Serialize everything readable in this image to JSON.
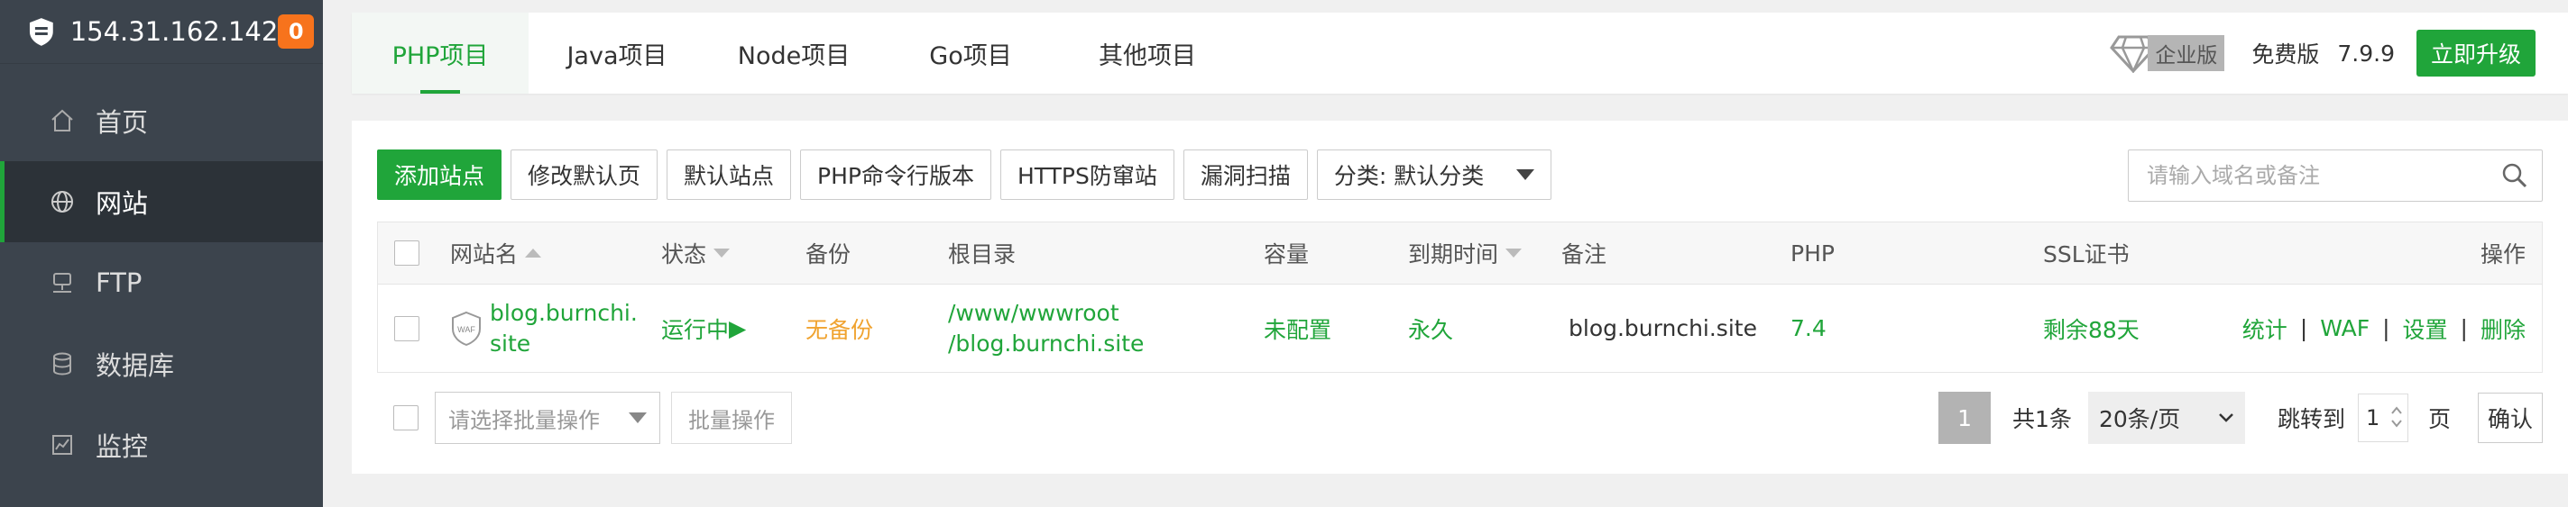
{
  "sidebar": {
    "server_ip": "154.31.162.142",
    "badge": "0",
    "items": [
      {
        "label": "首页",
        "icon": "home-icon"
      },
      {
        "label": "网站",
        "icon": "globe-icon",
        "active": true
      },
      {
        "label": "FTP",
        "icon": "ftp-icon"
      },
      {
        "label": "数据库",
        "icon": "database-icon"
      },
      {
        "label": "监控",
        "icon": "monitor-icon"
      }
    ]
  },
  "tabs": {
    "items": [
      "PHP项目",
      "Java项目",
      "Node项目",
      "Go项目",
      "其他项目"
    ],
    "active": 0,
    "enterprise_label": "企业版",
    "free_label": "免费版",
    "version": "7.9.9",
    "upgrade_label": "立即升级"
  },
  "toolbar": {
    "add_site": "添加站点",
    "modify_default_page": "修改默认页",
    "default_site": "默认站点",
    "php_cli_version": "PHP命令行版本",
    "https_firewall": "HTTPS防窜站",
    "vuln_scan": "漏洞扫描",
    "category_select": "分类: 默认分类",
    "search_placeholder": "请输入域名或备注"
  },
  "table": {
    "headers": {
      "name": "网站名",
      "status": "状态",
      "backup": "备份",
      "root": "根目录",
      "capacity": "容量",
      "expire": "到期时间",
      "remark": "备注",
      "php": "PHP",
      "ssl": "SSL证书",
      "ops": "操作"
    },
    "rows": [
      {
        "name_line1": "blog.burnchi.",
        "name_line2": "site",
        "waf_badge": "WAF",
        "status": "运行中",
        "status_icon": "▶",
        "backup": "无备份",
        "root_line1": "/www/wwwroot",
        "root_line2": "/blog.burnchi.site",
        "capacity": "未配置",
        "expire": "永久",
        "remark": "blog.burnchi.site",
        "php": "7.4",
        "ssl": "剩余88天",
        "ops": [
          "统计",
          "WAF",
          "设置",
          "删除"
        ]
      }
    ]
  },
  "footer": {
    "batch_placeholder": "请选择批量操作",
    "batch_button": "批量操作",
    "current_page": "1",
    "total": "共1条",
    "page_size": "20条/页",
    "jump_label": "跳转到",
    "jump_value": "1",
    "page_unit": "页",
    "confirm": "确认"
  },
  "colors": {
    "accent": "#20a53a",
    "sidebar_bg": "#3c444d",
    "badge": "#f7731c",
    "warning": "#f0a330"
  }
}
